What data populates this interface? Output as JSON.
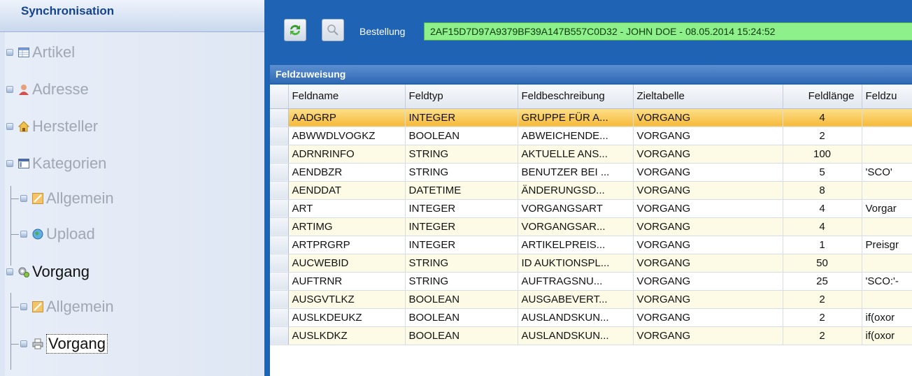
{
  "nav": {
    "header": "Synchronisation",
    "items": [
      {
        "label": "Artikel",
        "icon": "table-icon",
        "state": "dim"
      },
      {
        "label": "Adresse",
        "icon": "person-icon",
        "state": "dim"
      },
      {
        "label": "Hersteller",
        "icon": "house-icon",
        "state": "dim"
      },
      {
        "label": "Kategorien",
        "icon": "window-icon",
        "state": "dim"
      },
      {
        "label": "Allgemein",
        "icon": "edit-icon",
        "state": "dim"
      },
      {
        "label": "Upload",
        "icon": "globe-icon",
        "state": "dim"
      },
      {
        "label": "Vorgang",
        "icon": "gears-icon",
        "state": "active"
      },
      {
        "label": "Allgemein",
        "icon": "edit-icon",
        "state": "dim"
      },
      {
        "label": "Vorgang",
        "icon": "printer-icon",
        "state": "selected"
      }
    ]
  },
  "toolbar": {
    "order_label": "Bestellung",
    "order_value": "2AF15D7D97A9379BF39A147B557C0D32 - JOHN DOE - 08.05.2014 15:24:52",
    "colors": {
      "field_bg": "#8ef08a",
      "accent": "#1f64b4"
    }
  },
  "panel": {
    "title": "Feldzuweisung"
  },
  "table": {
    "columns": [
      "Feldname",
      "Feldtyp",
      "Feldbeschreibung",
      "Zieltabelle",
      "Feldlänge",
      "Feldzu"
    ],
    "rows": [
      [
        "AADGRP",
        "INTEGER",
        "GRUPPE FÜR A...",
        "VORGANG",
        "4",
        ""
      ],
      [
        "ABWWDLVOGKZ",
        "BOOLEAN",
        "ABWEICHENDE...",
        "VORGANG",
        "2",
        ""
      ],
      [
        "ADRNRINFO",
        "STRING",
        "AKTUELLE ANS...",
        "VORGANG",
        "100",
        ""
      ],
      [
        "AENDBZR",
        "STRING",
        "BENUTZER BEI ...",
        "VORGANG",
        "5",
        "'SCO'"
      ],
      [
        "AENDDAT",
        "DATETIME",
        "ÄNDERUNGSD...",
        "VORGANG",
        "8",
        ""
      ],
      [
        "ART",
        "INTEGER",
        "VORGANGSART",
        "VORGANG",
        "4",
        "Vorgar"
      ],
      [
        "ARTIMG",
        "INTEGER",
        "VORGANGSAR...",
        "VORGANG",
        "4",
        ""
      ],
      [
        "ARTPRGRP",
        "INTEGER",
        "ARTIKELPREIS...",
        "VORGANG",
        "1",
        "Preisgr"
      ],
      [
        "AUCWEBID",
        "STRING",
        "ID AUKTIONSPL...",
        "VORGANG",
        "50",
        ""
      ],
      [
        "AUFTRNR",
        "STRING",
        "AUFTRAGSNU...",
        "VORGANG",
        "25",
        "'SCO:'-"
      ],
      [
        "AUSGVTLKZ",
        "BOOLEAN",
        "AUSGABEVERT...",
        "VORGANG",
        "2",
        ""
      ],
      [
        "AUSLKDEUKZ",
        "BOOLEAN",
        "AUSLANDSKUN...",
        "VORGANG",
        "2",
        "if(oxor"
      ],
      [
        "AUSLKDKZ",
        "BOOLEAN",
        "AUSLANDSKUN...",
        "VORGANG",
        "2",
        "if(oxor"
      ]
    ]
  }
}
